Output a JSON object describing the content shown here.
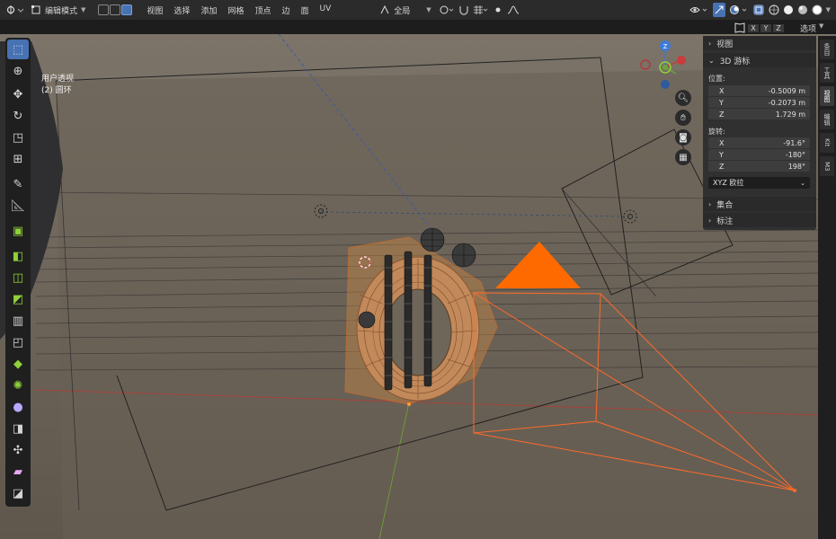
{
  "header": {
    "mode_label": "编辑模式",
    "menus": [
      "视图",
      "选择",
      "添加",
      "网格",
      "顶点",
      "边",
      "面",
      "UV"
    ],
    "transform_orientation": "全局",
    "options_label": "选项"
  },
  "axis_buttons": [
    "X",
    "Y",
    "Z"
  ],
  "viewport": {
    "view_name": "用户透视",
    "object_name": "(2) 圆环"
  },
  "npanel": {
    "sections": {
      "view": "视图",
      "cursor": "3D 游标",
      "collection": "集合",
      "annotation": "标注"
    },
    "location_label": "位置:",
    "location": [
      {
        "axis": "X",
        "value": "-0.5009 m"
      },
      {
        "axis": "Y",
        "value": "-0.2073 m"
      },
      {
        "axis": "Z",
        "value": "1.729 m"
      }
    ],
    "rotation_label": "旋转:",
    "rotation": [
      {
        "axis": "X",
        "value": "-91.6°"
      },
      {
        "axis": "Y",
        "value": "-180°"
      },
      {
        "axis": "Z",
        "value": "198°"
      }
    ],
    "rotation_mode": "XYZ 欧拉"
  },
  "side_tabs": [
    "条目",
    "工具",
    "视图",
    "编辑",
    "Kit",
    "M3"
  ],
  "colors": {
    "active_blue": "#4772b3",
    "selection_orange": "#ff7a1a",
    "viewport_bg": "#6f665a",
    "header_bg": "#2b2b2b"
  },
  "icons": {
    "toolbar": [
      "select-box-icon",
      "cursor-icon",
      "move-icon",
      "rotate-icon",
      "scale-icon",
      "transform-icon",
      "annotate-icon",
      "measure-icon",
      "add-cube-icon",
      "extrude-icon",
      "inset-icon",
      "bevel-icon",
      "loop-cut-icon",
      "knife-icon",
      "poly-build-icon",
      "spin-icon",
      "smooth-icon",
      "edge-slide-icon",
      "shrink-fatten-icon",
      "shear-icon",
      "rip-icon"
    ]
  }
}
